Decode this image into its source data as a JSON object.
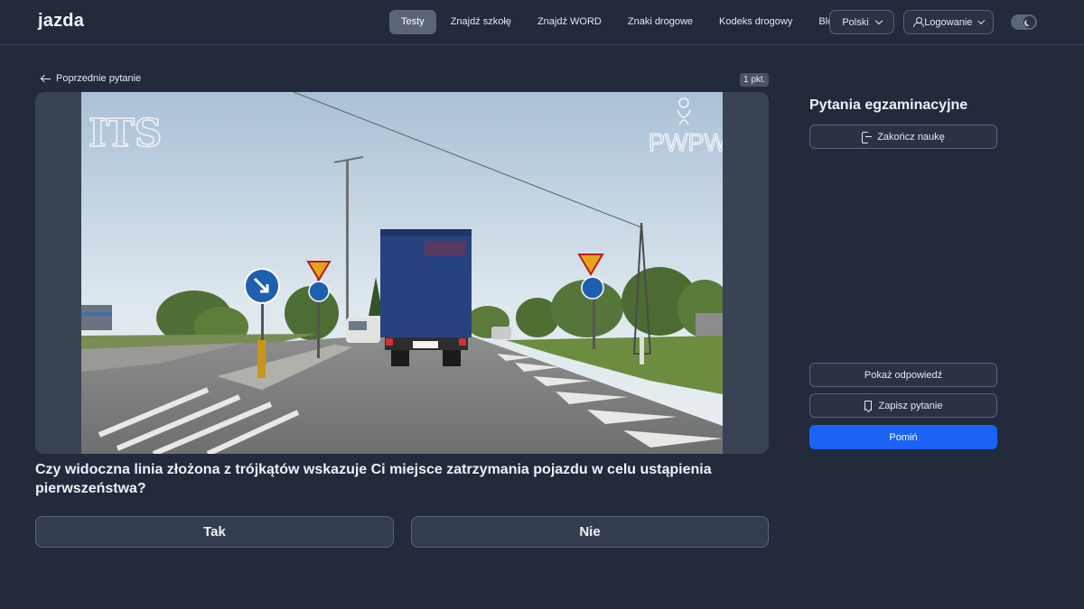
{
  "header": {
    "logo": "jazda",
    "nav": [
      {
        "label": "Testy",
        "active": true
      },
      {
        "label": "Znajdź szkołę",
        "active": false
      },
      {
        "label": "Znajdź WORD",
        "active": false
      },
      {
        "label": "Znaki drogowe",
        "active": false
      },
      {
        "label": "Kodeks drogowy",
        "active": false
      },
      {
        "label": "Blog",
        "active": false
      }
    ],
    "language": "Polski",
    "login": "Logowanie",
    "accent_color": "#1a63f5"
  },
  "main": {
    "prev_label": "Poprzednie pytanie",
    "points": "1 pkt.",
    "media": {
      "watermark_left": "ITS",
      "watermark_right": "PWPW"
    },
    "question": "Czy widoczna linia złożona z trójkątów wskazuje Ci miejsce zatrzymania pojazdu w celu ustąpienia pierwszeństwa?",
    "answers": {
      "yes": "Tak",
      "no": "Nie"
    }
  },
  "sidebar": {
    "title": "Pytania egzaminacyjne",
    "end_label": "Zakończ naukę",
    "show_answer_label": "Pokaż odpowiedź",
    "save_label": "Zapisz pytanie",
    "skip_label": "Pomiń"
  }
}
